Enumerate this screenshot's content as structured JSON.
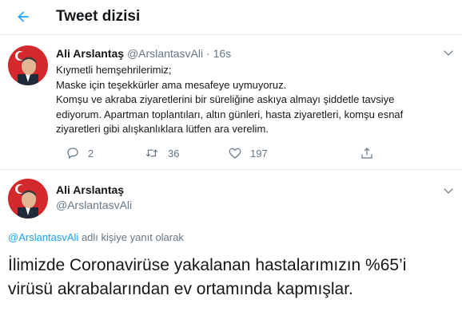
{
  "header": {
    "back_icon": "arrow-left-icon",
    "title": "Tweet dizisi"
  },
  "tweet1": {
    "name": "Ali Arslantaş",
    "handle": "@ArslantasvAli",
    "separator": "·",
    "time": "16s",
    "lines": [
      "Kıymetli hemşehrilerimiz;",
      "Maske için teşekkürler ama mesafeye uymuyoruz.",
      "Komşu ve akraba ziyaretlerini bir süreliğine askıya almayı şiddetle tavsiye",
      "ediyorum. Apartman toplantıları, altın günleri, hasta ziyaretleri, komşu esnaf",
      "ziyaretleri gibi alışkanlıklara lütfen ara verelim."
    ],
    "replies": "2",
    "retweets": "36",
    "likes": "197"
  },
  "tweet2": {
    "name": "Ali Arslantaş",
    "handle": "@ArslantasvAli",
    "reply_to_handle": "@ArslantasvAli",
    "reply_to_suffix": " adlı kişiye yanıt olarak",
    "lines": [
      "İlimizde Coronavirüse yakalanan hastalarımızın %65’i",
      "virüsü akrabalarından ev ortamında kapmışlar."
    ]
  },
  "colors": {
    "accent": "#1da1f2",
    "muted": "#657786",
    "text": "#14171a",
    "border": "#e6ecf0"
  }
}
